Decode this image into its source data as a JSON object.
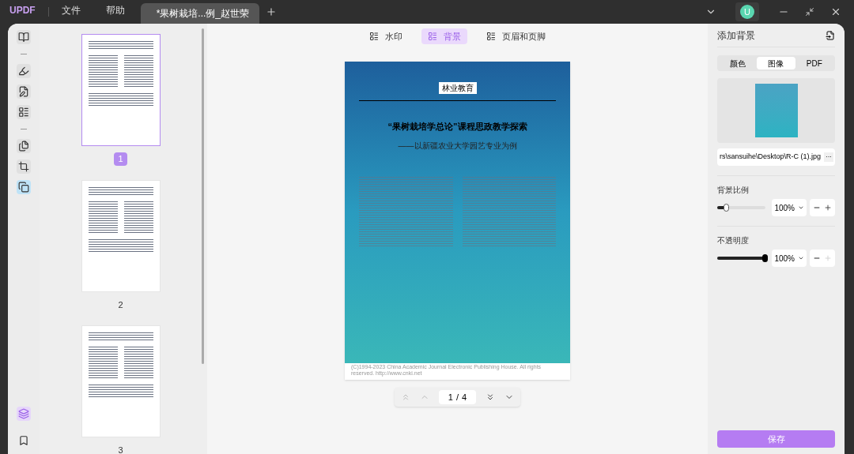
{
  "app": {
    "logo": "UPDF",
    "menus": [
      "文件",
      "帮助"
    ]
  },
  "tabs": [
    {
      "title": "*果树栽培...例_赵世荣",
      "selected": true
    }
  ],
  "user": {
    "initial": "U"
  },
  "tools": [
    {
      "kind": "icon",
      "selected": false
    },
    {
      "kind": "divider"
    },
    {
      "kind": "icon",
      "selected": false
    },
    {
      "kind": "icon",
      "selected": false
    },
    {
      "kind": "icon",
      "selected": false
    },
    {
      "kind": "divider"
    },
    {
      "kind": "icon",
      "selected": false
    },
    {
      "kind": "icon",
      "selected": false
    },
    {
      "kind": "icon",
      "selected": true
    }
  ],
  "bottom_tools": [
    {
      "selected": true
    },
    {
      "selected": false
    }
  ],
  "thumbnails": [
    {
      "label": "1",
      "selected": true
    },
    {
      "label": "2",
      "selected": false
    },
    {
      "label": "3",
      "selected": false
    }
  ],
  "toolbar": [
    {
      "label": "水印",
      "selected": false
    },
    {
      "label": "背景",
      "selected": true
    },
    {
      "label": "页眉和页脚",
      "selected": false
    }
  ],
  "document": {
    "journal": "林业教育",
    "title": "“果树栽培学总论”课程思政教学探索",
    "subtitle": "——以新疆农业大学园艺专业为例",
    "footer": "(C)1994-2023 China Academic Journal Electronic Publishing House. All rights reserved.    http://www.cnki.net"
  },
  "pager": {
    "current": "1",
    "separator": "/",
    "total": "4"
  },
  "panel": {
    "title": "添加背景",
    "source_tabs": [
      {
        "label": "颜色",
        "selected": false
      },
      {
        "label": "图像",
        "selected": true
      },
      {
        "label": "PDF",
        "selected": false
      }
    ],
    "file_path": "rs\\sansuihe\\Desktop\\R-C (1).jpg",
    "more": "···",
    "settings": [
      {
        "label": "背景比例",
        "kind": "scale",
        "level": 0.2,
        "value": "100%",
        "plus_disabled": false
      },
      {
        "label": "不透明度",
        "kind": "opacity",
        "level": 1,
        "value": "100%",
        "plus_disabled": true
      }
    ],
    "save": "保存"
  }
}
